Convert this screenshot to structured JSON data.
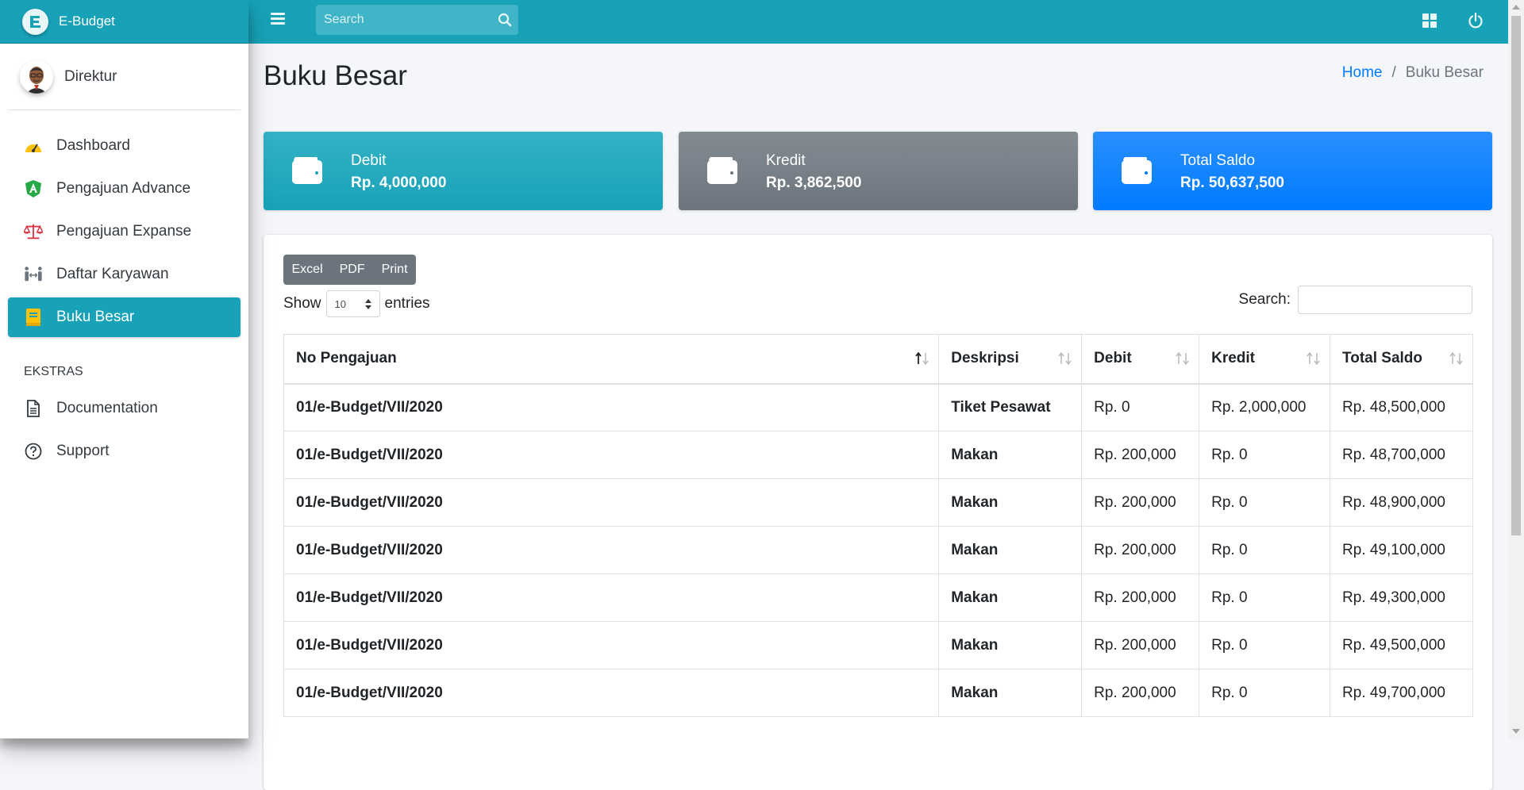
{
  "brand": {
    "name": "E-Budget"
  },
  "user": {
    "name": "Direktur"
  },
  "sidebar": {
    "items": [
      {
        "label": "Dashboard",
        "icon": "tachometer-icon"
      },
      {
        "label": "Pengajuan Advance",
        "icon": "angular-shield-icon"
      },
      {
        "label": "Pengajuan Expanse",
        "icon": "balance-scale-icon"
      },
      {
        "label": "Daftar Karyawan",
        "icon": "people-arrows-icon"
      },
      {
        "label": "Buku Besar",
        "icon": "book-icon",
        "active": true
      }
    ],
    "header": "EKSTRAS",
    "extras": [
      {
        "label": "Documentation",
        "icon": "file-icon"
      },
      {
        "label": "Support",
        "icon": "question-circle-icon"
      }
    ]
  },
  "topbar": {
    "search_placeholder": "Search"
  },
  "page": {
    "title": "Buku Besar"
  },
  "breadcrumb": {
    "home": "Home",
    "current": "Buku Besar"
  },
  "cards": [
    {
      "label": "Debit",
      "value": "Rp. 4,000,000",
      "color": "#17a2b8"
    },
    {
      "label": "Kredit",
      "value": "Rp. 3,862,500",
      "color": "#6c757d"
    },
    {
      "label": "Total Saldo",
      "value": "Rp. 50,637,500",
      "color": "#007bff"
    }
  ],
  "table_tools": {
    "buttons": [
      "Excel",
      "PDF",
      "Print"
    ],
    "show_label": "Show",
    "entries_value": "10",
    "entries_label": "entries",
    "search_label": "Search:"
  },
  "table": {
    "headers": [
      "No Pengajuan",
      "Deskripsi",
      "Debit",
      "Kredit",
      "Total Saldo"
    ],
    "rows": [
      [
        "01/e-Budget/VII/2020",
        "Tiket Pesawat",
        "Rp. 0",
        "Rp. 2,000,000",
        "Rp. 48,500,000"
      ],
      [
        "01/e-Budget/VII/2020",
        "Makan",
        "Rp. 200,000",
        "Rp. 0",
        "Rp. 48,700,000"
      ],
      [
        "01/e-Budget/VII/2020",
        "Makan",
        "Rp. 200,000",
        "Rp. 0",
        "Rp. 48,900,000"
      ],
      [
        "01/e-Budget/VII/2020",
        "Makan",
        "Rp. 200,000",
        "Rp. 0",
        "Rp. 49,100,000"
      ],
      [
        "01/e-Budget/VII/2020",
        "Makan",
        "Rp. 200,000",
        "Rp. 0",
        "Rp. 49,300,000"
      ],
      [
        "01/e-Budget/VII/2020",
        "Makan",
        "Rp. 200,000",
        "Rp. 0",
        "Rp. 49,500,000"
      ],
      [
        "01/e-Budget/VII/2020",
        "Makan",
        "Rp. 200,000",
        "Rp. 0",
        "Rp. 49,700,000"
      ]
    ]
  }
}
